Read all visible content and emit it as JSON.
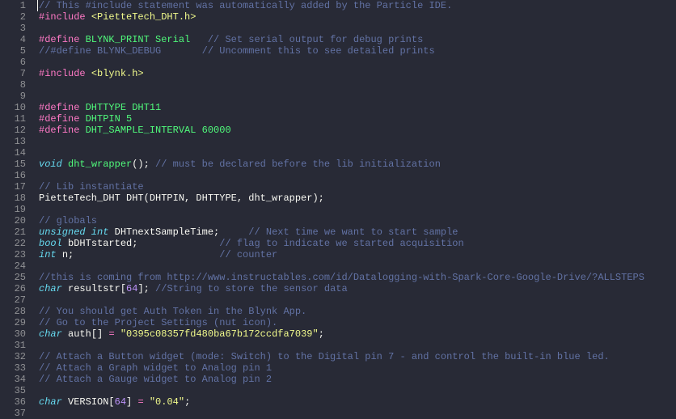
{
  "lines": [
    {
      "n": 1,
      "tokens": [
        [
          "cm",
          "// This #include statement was automatically added by the Particle IDE."
        ]
      ]
    },
    {
      "n": 2,
      "tokens": [
        [
          "pp",
          "#include "
        ],
        [
          "str",
          "<PietteTech_DHT.h>"
        ]
      ]
    },
    {
      "n": 3,
      "tokens": []
    },
    {
      "n": 4,
      "tokens": [
        [
          "pp",
          "#define "
        ],
        [
          "fn",
          "BLYNK_PRINT Serial"
        ],
        [
          "id",
          "   "
        ],
        [
          "cm",
          "// Set serial output for debug prints"
        ]
      ]
    },
    {
      "n": 5,
      "tokens": [
        [
          "cm",
          "//#define BLYNK_DEBUG       // Uncomment this to see detailed prints"
        ]
      ]
    },
    {
      "n": 6,
      "tokens": []
    },
    {
      "n": 7,
      "tokens": [
        [
          "pp",
          "#include "
        ],
        [
          "str",
          "<blynk.h>"
        ]
      ]
    },
    {
      "n": 8,
      "tokens": []
    },
    {
      "n": 9,
      "tokens": []
    },
    {
      "n": 10,
      "tokens": [
        [
          "pp",
          "#define "
        ],
        [
          "fn",
          "DHTTYPE DHT11"
        ]
      ]
    },
    {
      "n": 11,
      "tokens": [
        [
          "pp",
          "#define "
        ],
        [
          "fn",
          "DHTPIN 5"
        ]
      ]
    },
    {
      "n": 12,
      "tokens": [
        [
          "pp",
          "#define "
        ],
        [
          "fn",
          "DHT_SAMPLE_INTERVAL 60000"
        ]
      ]
    },
    {
      "n": 13,
      "tokens": []
    },
    {
      "n": 14,
      "tokens": []
    },
    {
      "n": 15,
      "tokens": [
        [
          "ty",
          "void "
        ],
        [
          "fn",
          "dht_wrapper"
        ],
        [
          "id",
          "(); "
        ],
        [
          "cm",
          "// must be declared before the lib initialization"
        ]
      ]
    },
    {
      "n": 16,
      "tokens": []
    },
    {
      "n": 17,
      "tokens": [
        [
          "cm",
          "// Lib instantiate"
        ]
      ]
    },
    {
      "n": 18,
      "tokens": [
        [
          "id",
          "PietteTech_DHT DHT(DHTPIN, DHTTYPE, dht_wrapper);"
        ]
      ]
    },
    {
      "n": 19,
      "tokens": []
    },
    {
      "n": 20,
      "tokens": [
        [
          "cm",
          "// globals"
        ]
      ]
    },
    {
      "n": 21,
      "tokens": [
        [
          "ty",
          "unsigned int "
        ],
        [
          "id",
          "DHTnextSampleTime;     "
        ],
        [
          "cm",
          "// Next time we want to start sample"
        ]
      ]
    },
    {
      "n": 22,
      "tokens": [
        [
          "ty",
          "bool "
        ],
        [
          "id",
          "bDHTstarted;              "
        ],
        [
          "cm",
          "// flag to indicate we started acquisition"
        ]
      ]
    },
    {
      "n": 23,
      "tokens": [
        [
          "ty",
          "int "
        ],
        [
          "id",
          "n;                         "
        ],
        [
          "cm",
          "// counter"
        ]
      ]
    },
    {
      "n": 24,
      "tokens": []
    },
    {
      "n": 25,
      "tokens": [
        [
          "cm",
          "//this is coming from http://www.instructables.com/id/Datalogging-with-Spark-Core-Google-Drive/?ALLSTEPS"
        ]
      ]
    },
    {
      "n": 26,
      "tokens": [
        [
          "ty",
          "char "
        ],
        [
          "id",
          "resultstr["
        ],
        [
          "num",
          "64"
        ],
        [
          "id",
          "]; "
        ],
        [
          "cm",
          "//String to store the sensor data"
        ]
      ]
    },
    {
      "n": 27,
      "tokens": []
    },
    {
      "n": 28,
      "tokens": [
        [
          "cm",
          "// You should get Auth Token in the Blynk App."
        ]
      ]
    },
    {
      "n": 29,
      "tokens": [
        [
          "cm",
          "// Go to the Project Settings (nut icon)."
        ]
      ]
    },
    {
      "n": 30,
      "tokens": [
        [
          "ty",
          "char "
        ],
        [
          "id",
          "auth[] "
        ],
        [
          "op",
          "="
        ],
        [
          "id",
          " "
        ],
        [
          "str",
          "\"0395c08357fd480ba67b172ccdfa7039\""
        ],
        [
          "id",
          ";"
        ]
      ]
    },
    {
      "n": 31,
      "tokens": []
    },
    {
      "n": 32,
      "tokens": [
        [
          "cm",
          "// Attach a Button widget (mode: Switch) to the Digital pin 7 - and control the built-in blue led."
        ]
      ]
    },
    {
      "n": 33,
      "tokens": [
        [
          "cm",
          "// Attach a Graph widget to Analog pin 1"
        ]
      ]
    },
    {
      "n": 34,
      "tokens": [
        [
          "cm",
          "// Attach a Gauge widget to Analog pin 2"
        ]
      ]
    },
    {
      "n": 35,
      "tokens": []
    },
    {
      "n": 36,
      "tokens": [
        [
          "ty",
          "char "
        ],
        [
          "id",
          "VERSION["
        ],
        [
          "num",
          "64"
        ],
        [
          "id",
          "] "
        ],
        [
          "op",
          "="
        ],
        [
          "id",
          " "
        ],
        [
          "str",
          "\"0.04\""
        ],
        [
          "id",
          ";"
        ]
      ]
    },
    {
      "n": 37,
      "tokens": []
    }
  ]
}
